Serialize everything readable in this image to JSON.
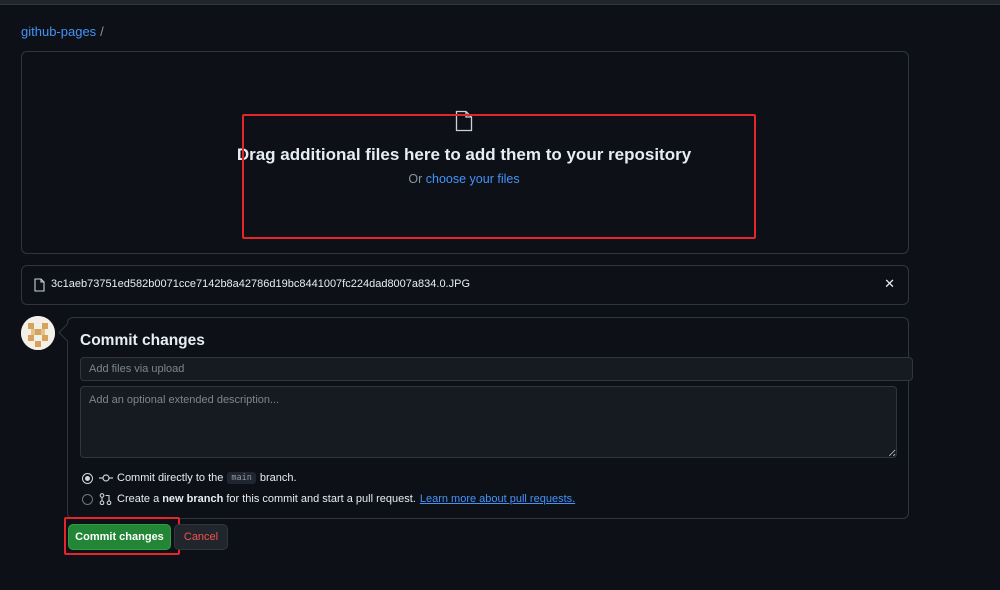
{
  "breadcrumb": {
    "repo": "github-pages",
    "separator": "/"
  },
  "dropzone": {
    "title": "Drag additional files here to add them to your repository",
    "prefix": "Or",
    "link": "choose your files",
    "icon": "file-icon"
  },
  "uploaded_file": {
    "name": "3c1aeb73751ed582b0071cce7142b8a42786d19bc8441007fc224dad8007a834.0.JPG",
    "remove_label": "✕",
    "icon": "file-icon"
  },
  "commit": {
    "title": "Commit changes",
    "summary_placeholder": "Add files via upload",
    "description_placeholder": "Add an optional extended description...",
    "options": [
      {
        "checked": true,
        "icon": "git-commit-icon",
        "pre": "Commit directly to the",
        "branch": "main",
        "post": "branch."
      },
      {
        "checked": false,
        "icon": "git-pull-request-icon",
        "pre": "Create a",
        "bold": "new branch",
        "post": "for this commit and start a pull request.",
        "link": "Learn more about pull requests."
      }
    ],
    "submit_label": "Commit changes",
    "cancel_label": "Cancel"
  },
  "colors": {
    "background": "#0d1117",
    "link": "#4493f8",
    "primary_button": "#238636",
    "danger_text": "#f85149",
    "highlight": "#e5252a"
  }
}
